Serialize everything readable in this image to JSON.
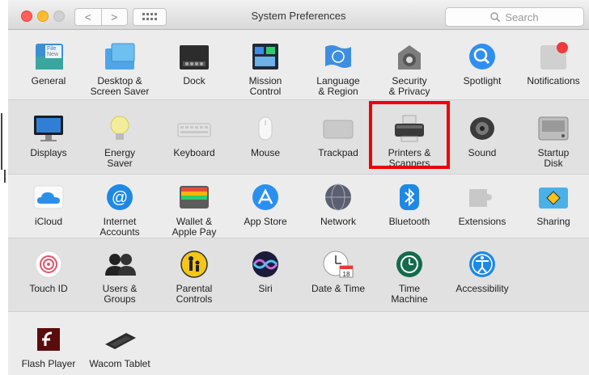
{
  "window": {
    "title": "System Preferences",
    "search_placeholder": "Search",
    "back_glyph": "<",
    "forward_glyph": ">"
  },
  "rows": [
    [
      {
        "label": "General",
        "icon": "general-icon"
      },
      {
        "label": "Desktop &\nScreen Saver",
        "icon": "desktop-screensaver-icon"
      },
      {
        "label": "Dock",
        "icon": "dock-icon"
      },
      {
        "label": "Mission\nControl",
        "icon": "mission-control-icon"
      },
      {
        "label": "Language\n& Region",
        "icon": "language-region-icon"
      },
      {
        "label": "Security\n& Privacy",
        "icon": "security-privacy-icon"
      },
      {
        "label": "Spotlight",
        "icon": "spotlight-icon"
      },
      {
        "label": "Notifications",
        "icon": "notifications-icon"
      }
    ],
    [
      {
        "label": "Displays",
        "icon": "displays-icon"
      },
      {
        "label": "Energy\nSaver",
        "icon": "energy-saver-icon"
      },
      {
        "label": "Keyboard",
        "icon": "keyboard-icon"
      },
      {
        "label": "Mouse",
        "icon": "mouse-icon"
      },
      {
        "label": "Trackpad",
        "icon": "trackpad-icon"
      },
      {
        "label": "Printers &\nScanners",
        "icon": "printers-scanners-icon",
        "highlighted": true
      },
      {
        "label": "Sound",
        "icon": "sound-icon"
      },
      {
        "label": "Startup\nDisk",
        "icon": "startup-disk-icon"
      }
    ],
    [
      {
        "label": "iCloud",
        "icon": "icloud-icon"
      },
      {
        "label": "Internet\nAccounts",
        "icon": "internet-accounts-icon"
      },
      {
        "label": "Wallet &\nApple Pay",
        "icon": "wallet-applepay-icon"
      },
      {
        "label": "App Store",
        "icon": "app-store-icon"
      },
      {
        "label": "Network",
        "icon": "network-icon"
      },
      {
        "label": "Bluetooth",
        "icon": "bluetooth-icon"
      },
      {
        "label": "Extensions",
        "icon": "extensions-icon"
      },
      {
        "label": "Sharing",
        "icon": "sharing-icon"
      }
    ],
    [
      {
        "label": "Touch ID",
        "icon": "touch-id-icon"
      },
      {
        "label": "Users &\nGroups",
        "icon": "users-groups-icon"
      },
      {
        "label": "Parental\nControls",
        "icon": "parental-controls-icon"
      },
      {
        "label": "Siri",
        "icon": "siri-icon"
      },
      {
        "label": "Date & Time",
        "icon": "date-time-icon",
        "icon_text": "18"
      },
      {
        "label": "Time\nMachine",
        "icon": "time-machine-icon"
      },
      {
        "label": "Accessibility",
        "icon": "accessibility-icon"
      }
    ],
    [
      {
        "label": "Flash Player",
        "icon": "flash-player-icon"
      },
      {
        "label": "Wacom Tablet",
        "icon": "wacom-tablet-icon"
      }
    ]
  ],
  "general_icon_text": "File\nNew\nOpe",
  "colors": {
    "highlight": "#ee0000",
    "accent_blue": "#1e88e5"
  }
}
